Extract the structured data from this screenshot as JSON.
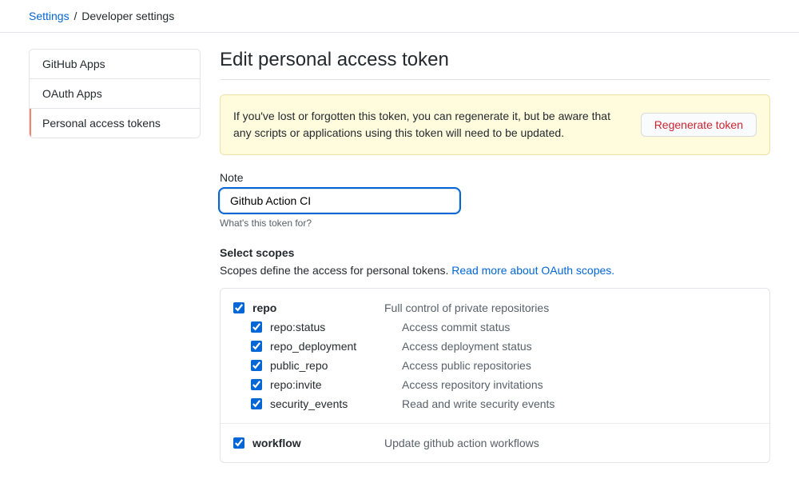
{
  "breadcrumb": {
    "parent": "Settings",
    "current": "Developer settings"
  },
  "sidebar": {
    "items": [
      {
        "label": "GitHub Apps",
        "active": false
      },
      {
        "label": "OAuth Apps",
        "active": false
      },
      {
        "label": "Personal access tokens",
        "active": true
      }
    ]
  },
  "page_title": "Edit personal access token",
  "alert": {
    "text": "If you've lost or forgotten this token, you can regenerate it, but be aware that any scripts or applications using this token will need to be updated.",
    "button": "Regenerate token"
  },
  "note": {
    "label": "Note",
    "value": "Github Action CI",
    "help": "What's this token for?"
  },
  "scopes": {
    "title": "Select scopes",
    "description_text": "Scopes define the access for personal tokens. ",
    "link_text": "Read more about OAuth scopes.",
    "groups": [
      {
        "name": "repo",
        "desc": "Full control of private repositories",
        "checked": true,
        "children": [
          {
            "name": "repo:status",
            "desc": "Access commit status",
            "checked": true
          },
          {
            "name": "repo_deployment",
            "desc": "Access deployment status",
            "checked": true
          },
          {
            "name": "public_repo",
            "desc": "Access public repositories",
            "checked": true
          },
          {
            "name": "repo:invite",
            "desc": "Access repository invitations",
            "checked": true
          },
          {
            "name": "security_events",
            "desc": "Read and write security events",
            "checked": true
          }
        ]
      },
      {
        "name": "workflow",
        "desc": "Update github action workflows",
        "checked": true,
        "children": []
      }
    ]
  }
}
